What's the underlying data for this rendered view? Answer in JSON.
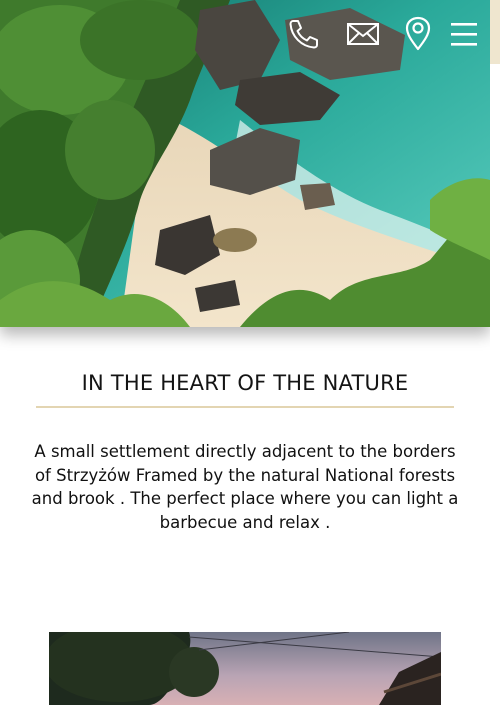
{
  "header": {
    "icons": [
      "phone-icon",
      "mail-icon",
      "location-pin-icon",
      "menu-icon"
    ]
  },
  "hero": {
    "image": "tropical beach cove with rocks, turquoise water and green jungle"
  },
  "section": {
    "heading": "IN THE HEART OF THE NATURE",
    "text": "A small settlement directly adjacent to the borders of Strzyżów Framed by the natural National forests and brook . The perfect place where you can light a barbecue and relax ."
  },
  "photo": {
    "image": "dusk photo of trees, power lines and a wooden roof"
  },
  "colors": {
    "accent_gold": "#e3d5b2",
    "scroll_thumb": "#efe6cf",
    "text": "#141414"
  }
}
